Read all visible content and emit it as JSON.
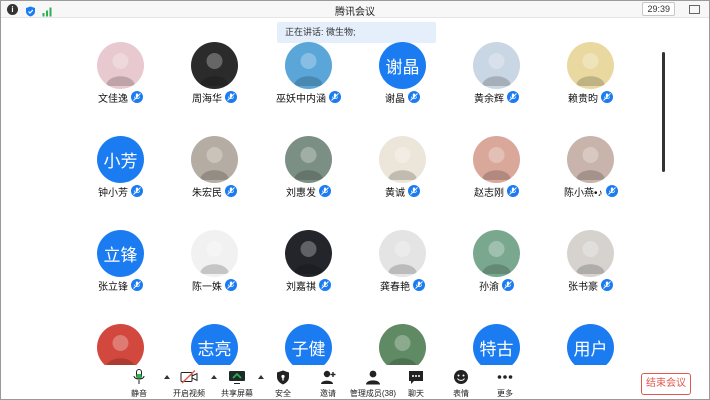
{
  "window": {
    "title": "腾讯会议",
    "clock": "29:39"
  },
  "banner": {
    "speaking": "正在讲话: 微生物;"
  },
  "participants": [
    {
      "name": "文佳逸",
      "avatar_text": "",
      "avatar_color": "#e8c9cf",
      "avatar_kind": "photo"
    },
    {
      "name": "周海华",
      "avatar_text": "",
      "avatar_color": "#2b2b2b",
      "avatar_kind": "photo"
    },
    {
      "name": "巫妖中内涵",
      "avatar_text": "",
      "avatar_color": "#5aa6d8",
      "avatar_kind": "photo"
    },
    {
      "name": "谢晶",
      "avatar_text": "谢晶",
      "avatar_color": "#1b7cf2",
      "avatar_kind": "text"
    },
    {
      "name": "黄余辉",
      "avatar_text": "",
      "avatar_color": "#c9d6e3",
      "avatar_kind": "photo"
    },
    {
      "name": "赖贵昀",
      "avatar_text": "",
      "avatar_color": "#e9d9a0",
      "avatar_kind": "photo"
    },
    {
      "name": "钟小芳",
      "avatar_text": "小芳",
      "avatar_color": "#1b7cf2",
      "avatar_kind": "text"
    },
    {
      "name": "朱宏民",
      "avatar_text": "",
      "avatar_color": "#b5aca3",
      "avatar_kind": "photo"
    },
    {
      "name": "刘惠发",
      "avatar_text": "",
      "avatar_color": "#7c8f84",
      "avatar_kind": "photo"
    },
    {
      "name": "黄诚",
      "avatar_text": "",
      "avatar_color": "#ece6da",
      "avatar_kind": "photo"
    },
    {
      "name": "赵志刚",
      "avatar_text": "",
      "avatar_color": "#d9a89a",
      "avatar_kind": "photo"
    },
    {
      "name": "陈小燕•♪",
      "avatar_text": "",
      "avatar_color": "#c8b4aa",
      "avatar_kind": "photo"
    },
    {
      "name": "张立锋",
      "avatar_text": "立锋",
      "avatar_color": "#1b7cf2",
      "avatar_kind": "text"
    },
    {
      "name": "陈一姝",
      "avatar_text": "",
      "avatar_color": "#f1f1f1",
      "avatar_kind": "photo"
    },
    {
      "name": "刘嘉祺",
      "avatar_text": "",
      "avatar_color": "#23252b",
      "avatar_kind": "photo"
    },
    {
      "name": "龚春艳",
      "avatar_text": "",
      "avatar_color": "#e4e4e4",
      "avatar_kind": "photo"
    },
    {
      "name": "孙渝",
      "avatar_text": "",
      "avatar_color": "#7aa88f",
      "avatar_kind": "photo"
    },
    {
      "name": "张书豪",
      "avatar_text": "",
      "avatar_color": "#d6d3cf",
      "avatar_kind": "photo"
    },
    {
      "name": "",
      "avatar_text": "",
      "avatar_color": "#d2483e",
      "avatar_kind": "photo"
    },
    {
      "name": "",
      "avatar_text": "志亮",
      "avatar_color": "#1b7cf2",
      "avatar_kind": "text"
    },
    {
      "name": "",
      "avatar_text": "子健",
      "avatar_color": "#1b7cf2",
      "avatar_kind": "text"
    },
    {
      "name": "",
      "avatar_text": "",
      "avatar_color": "#5f8a63",
      "avatar_kind": "photo"
    },
    {
      "name": "",
      "avatar_text": "特古",
      "avatar_color": "#1b7cf2",
      "avatar_kind": "text"
    },
    {
      "name": "",
      "avatar_text": "用户",
      "avatar_color": "#1b7cf2",
      "avatar_kind": "text"
    }
  ],
  "toolbar": {
    "mute": "静音",
    "video": "开启视频",
    "share": "共享屏幕",
    "security": "安全",
    "invite": "邀请",
    "members": "管理成员(38)",
    "chat": "聊天",
    "reaction": "表情",
    "more": "更多",
    "end": "结束会议"
  },
  "colors": {
    "accent": "#1b7cf2",
    "end": "#e2574c",
    "banner": "#e5eefb"
  }
}
